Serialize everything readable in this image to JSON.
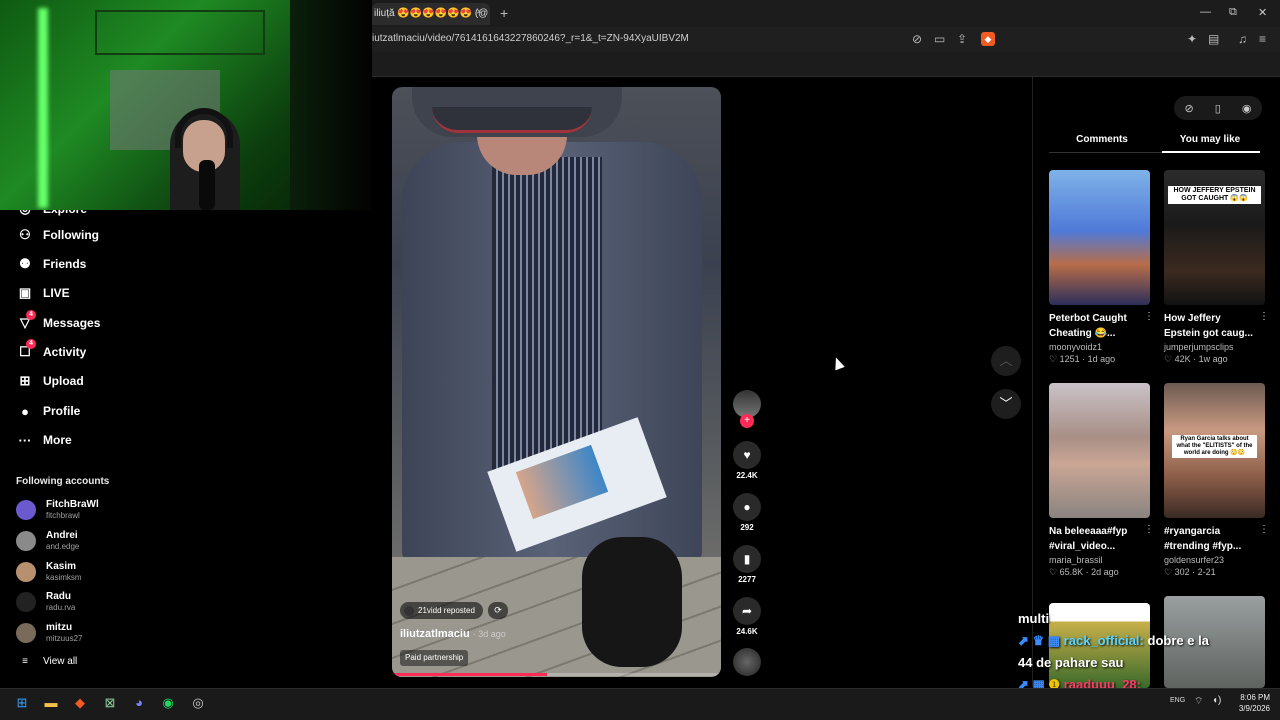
{
  "browser": {
    "tab_title": "iliuță 😍😍😍😍😍😍 (@",
    "tab_close": "×",
    "new_tab": "+",
    "url": "iutzatlmaciu/video/7614161643227860246?_r=1&_t=ZN-94XyaUIBV2M",
    "window_controls": [
      "—",
      "⧉",
      "✕"
    ]
  },
  "sidebar": {
    "partial_item": "Explore",
    "items": [
      {
        "label": "Following",
        "icon": "following-icon"
      },
      {
        "label": "Friends",
        "icon": "friends-icon"
      },
      {
        "label": "LIVE",
        "icon": "live-icon"
      },
      {
        "label": "Messages",
        "icon": "messages-icon",
        "badge": "4"
      },
      {
        "label": "Activity",
        "icon": "activity-icon",
        "badge": "4"
      },
      {
        "label": "Upload",
        "icon": "upload-icon"
      },
      {
        "label": "Profile",
        "icon": "profile-icon"
      },
      {
        "label": "More",
        "icon": "more-icon"
      }
    ],
    "following_header": "Following accounts",
    "accounts": [
      {
        "name": "FitchBraWl",
        "handle": "fitchbrawl",
        "color": "#6a5acd"
      },
      {
        "name": "Andrei",
        "handle": "and.edge",
        "color": "#8a8a8a"
      },
      {
        "name": "Kasim",
        "handle": "kasimksm",
        "color": "#b89070"
      },
      {
        "name": "Radu",
        "handle": "radu.rva",
        "color": "#222222"
      },
      {
        "name": "mitzu",
        "handle": "mitzuus27",
        "color": "#7a6a5a"
      }
    ],
    "view_all": "View all"
  },
  "video": {
    "repost_text": "21vidd reposted",
    "author": "iliutzatlmaciu",
    "age": "· 3d ago",
    "paid": "Paid partnership",
    "progress": 0.47
  },
  "actions": {
    "likes": "22.4K",
    "comments": "292",
    "saves": "2277",
    "shares": "24.6K"
  },
  "panel": {
    "tab_comments": "Comments",
    "tab_you_may_like": "You may like",
    "active_tab": "You may like",
    "cards": [
      {
        "title": "Peterbot Caught",
        "title2": "Cheating 😂...",
        "user": "moonyvoidz1",
        "likes": "♡ 1251",
        "age": "1d ago",
        "overlay": ""
      },
      {
        "title": "How Jeffery",
        "title2": "Epstein got caug...",
        "user": "jumperjumpsclips",
        "likes": "♡ 42K",
        "age": "1w ago",
        "overlay": "HOW JEFFERY EPSTEIN GOT CAUGHT 😱😱"
      },
      {
        "title": "Na beleeaaa#fyp",
        "title2": "#viral_video...",
        "user": "maria_brassil",
        "likes": "♡ 65.8K",
        "age": "2d ago",
        "overlay": ""
      },
      {
        "title": "#ryangarcia",
        "title2": "#trending #fyp...",
        "user": "goldensurfer23",
        "likes": "♡ 302",
        "age": "2-21",
        "overlay": "Ryan Garcia talks about what the \"ELITISTS\" of the world are doing 😳😳"
      }
    ]
  },
  "chat": {
    "line1": "multi",
    "line2_user": "rack_official:",
    "line2_msg": "dobre e la",
    "line3": "44 de pahare sau",
    "line4_user": "raaduuu_28:"
  },
  "taskbar": {
    "time": "8:06 PM",
    "date": "3/9/2026",
    "lang": "ENG"
  }
}
